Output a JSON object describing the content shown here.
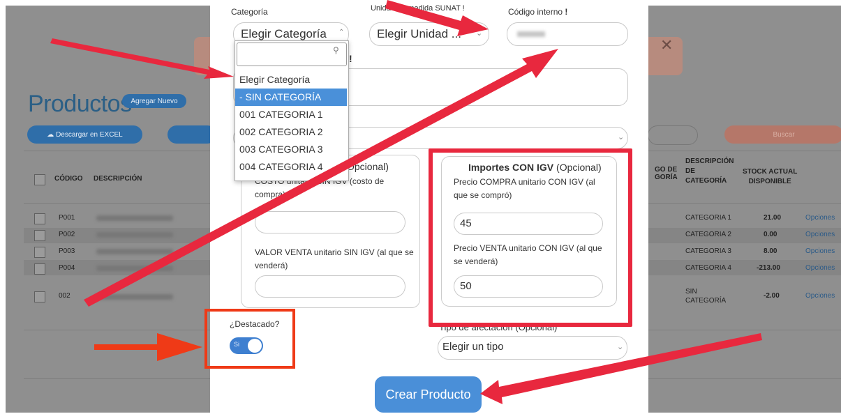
{
  "background": {
    "page_title": "Productos",
    "add_new_button": "Agregar Nuevo",
    "download_excel_button": "Descargar en EXCEL",
    "filter_button": "Buscar",
    "table": {
      "headers": {
        "code": "CÓDIGO",
        "description": "DESCRIPCIÓN",
        "category_code": "GO DE\nGORÍA",
        "category_description": "DESCRIPCIÓN\nDE\nCATEGORÍA",
        "stock": "STOCK ACTUAL\nDISPONIBLE"
      },
      "rows": [
        {
          "code": "P001",
          "category": "CATEGORIA 1",
          "stock": "21.00",
          "options": "Opciones"
        },
        {
          "code": "P002",
          "category": "CATEGORIA 2",
          "stock": "0.00",
          "options": "Opciones"
        },
        {
          "code": "P003",
          "category": "CATEGORIA 3",
          "stock": "8.00",
          "options": "Opciones"
        },
        {
          "code": "P004",
          "category": "CATEGORIA 4",
          "stock": "-213.00",
          "options": "Opciones"
        },
        {
          "code": "002",
          "category": "SIN\nCATEGORÍA",
          "stock": "-2.00",
          "options": "Opciones"
        }
      ]
    },
    "alert_close": "✕"
  },
  "modal": {
    "category_label": "Categoría",
    "category_value": "Elegir Categoría",
    "unit_label": "Unidad de medida SUNAT !",
    "unit_value": "Elegir Unidad ...",
    "internal_code_label": "Código interno",
    "exclamation": "!",
    "dropdown": {
      "search_placeholder": "",
      "options": [
        "Elegir Categoría",
        "- SIN CATEGORÍA",
        "001 CATEGORIA 1",
        "002 CATEGORIA 2",
        "003 CATEGORIA 3",
        "004 CATEGORIA 4"
      ],
      "selected_index": 1
    },
    "without_igv": {
      "title_suffix": "Opcional)",
      "cost_label": "COSTO unitario SIN IGV (costo de compra)",
      "sale_label": "VALOR VENTA unitario SIN IGV (al que se venderá)"
    },
    "with_igv": {
      "title_bold": "Importes CON IGV",
      "title_rest": " (Opcional)",
      "purchase_label": "Precio COMPRA unitario CON IGV (al que se compró)",
      "purchase_value": "45",
      "sale_label": "Precio VENTA unitario CON IGV (al que se venderá)",
      "sale_value": "50"
    },
    "featured_label": "¿Destacado?",
    "featured_toggle_text": "Si",
    "affectation_label": "Tipo de afectación (Opcional)",
    "affectation_value": "Elegir un tipo",
    "create_button": "Crear Producto"
  },
  "colors": {
    "annotation_red": "#e8283e",
    "annotation_orange": "#ef3a17",
    "primary_blue": "#4a8fd8"
  }
}
